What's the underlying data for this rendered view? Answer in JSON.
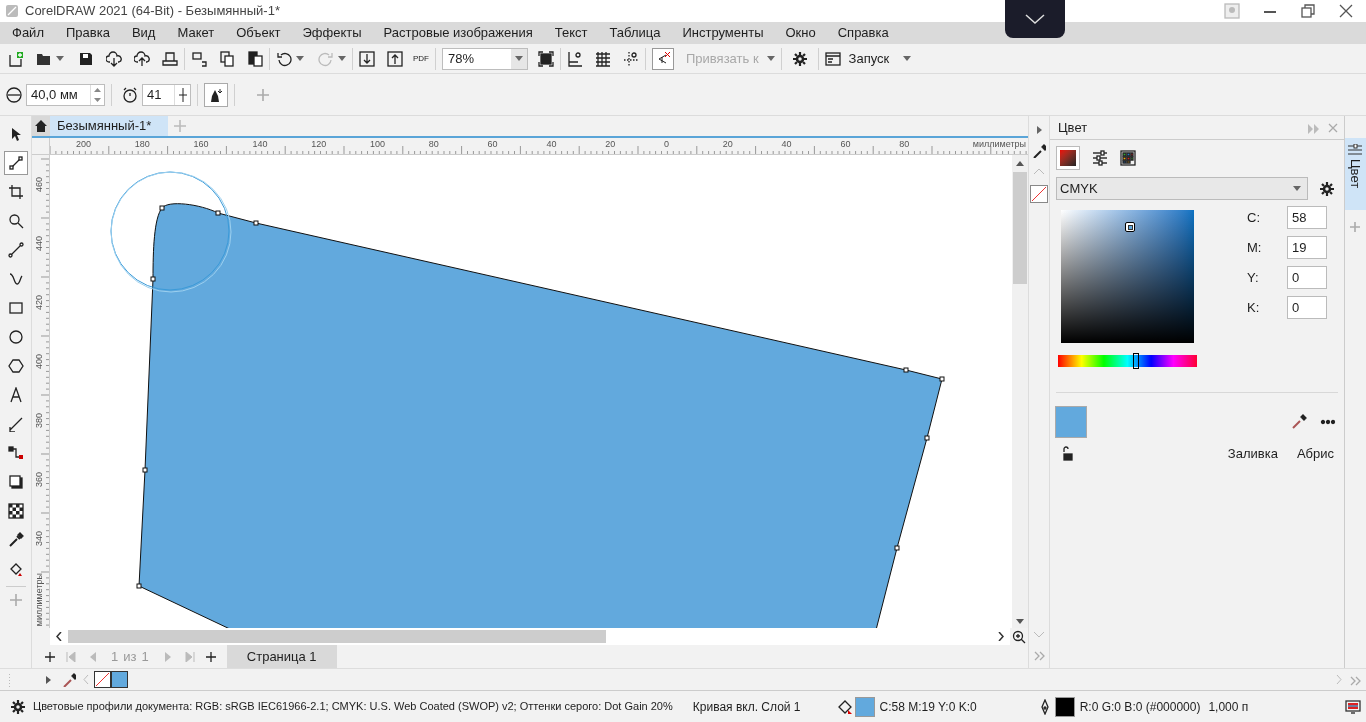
{
  "window": {
    "title": "CorelDRAW 2021 (64-Bit) - Безымянный-1*"
  },
  "menu": [
    "Файл",
    "Правка",
    "Вид",
    "Макет",
    "Объект",
    "Эффекты",
    "Растровые изображения",
    "Текст",
    "Таблица",
    "Инструменты",
    "Окно",
    "Справка"
  ],
  "toolbar": {
    "pdf_label": "PDF",
    "zoom": "78%",
    "snap": {
      "label": "Привязать к",
      "disabled": true
    },
    "launch": "Запуск"
  },
  "property_bar": {
    "nib_size": "40,0 мм",
    "pressure": "41"
  },
  "toolbox": [
    {
      "kind": "pick",
      "selected": false
    },
    {
      "kind": "shape",
      "selected": true
    },
    {
      "kind": "crop",
      "selected": false
    },
    {
      "kind": "zoom",
      "selected": false
    },
    {
      "kind": "freehand",
      "selected": false
    },
    {
      "kind": "artistic",
      "selected": false
    },
    {
      "kind": "rectangle",
      "selected": false
    },
    {
      "kind": "ellipse",
      "selected": false
    },
    {
      "kind": "polygon",
      "selected": false
    },
    {
      "kind": "text",
      "selected": false
    },
    {
      "kind": "dimension",
      "selected": false
    },
    {
      "kind": "connector",
      "selected": false
    },
    {
      "kind": "shadow",
      "selected": false
    },
    {
      "kind": "transparency",
      "selected": false
    },
    {
      "kind": "eyedropper",
      "selected": false
    },
    {
      "kind": "fill",
      "selected": false
    }
  ],
  "document_tab": {
    "title": "Безымянный-1*"
  },
  "ruler_h": {
    "ticks": [
      "200",
      "180",
      "160",
      "140",
      "120",
      "100",
      "80",
      "60",
      "40",
      "20",
      "0",
      "20",
      "40",
      "60",
      "80"
    ],
    "unit": "миллиметры"
  },
  "ruler_v": {
    "ticks": [
      "460",
      "440",
      "420",
      "400",
      "380",
      "360",
      "340"
    ],
    "unit": "миллиметры"
  },
  "page_nav": {
    "current": "1",
    "of": "из",
    "total": "1",
    "page_tab": "Страница 1"
  },
  "palette": [
    {
      "kind": "none"
    },
    {
      "kind": "color",
      "color": "#62a9dd"
    }
  ],
  "color_panel": {
    "title": "Цвет",
    "model": "CMYK",
    "components": [
      {
        "label": "C:",
        "value": "58"
      },
      {
        "label": "M:",
        "value": "19"
      },
      {
        "label": "Y:",
        "value": "0"
      },
      {
        "label": "K:",
        "value": "0"
      }
    ],
    "hue": {
      "level": 0.56
    },
    "swatch": {
      "color": "#62a9dd"
    },
    "fill_button": "Заливка",
    "outline_button": "Абрис"
  },
  "side_tab": {
    "label": "Цвет",
    "selected": true
  },
  "status_bar": {
    "profiles": "Цветовые профили документа: RGB: sRGB IEC61966-2.1; CMYK: U.S. Web Coated (SWOP) v2; Оттенки серого: Dot Gain 20%",
    "object": "Кривая вкл. Слой 1",
    "indicators": [
      {
        "kind": "fill",
        "color": "#62a9dd",
        "text": "C:58 M:19 Y:0 K:0"
      },
      {
        "kind": "outline",
        "color": "#000000",
        "text": "R:0 G:0 B:0 (#000000)"
      }
    ],
    "outline_width": "1,000 п"
  }
}
